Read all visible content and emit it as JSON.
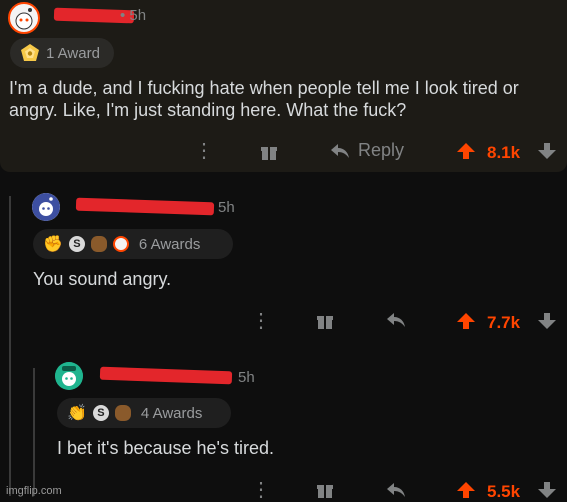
{
  "comments": [
    {
      "time": "• 5h",
      "award_label": "1 Award",
      "body_line1": "I'm a dude, and I fucking hate when people tell me I look tired or",
      "body_line2": "angry. Like, I'm just standing here. What the fuck?",
      "reply_label": "Reply",
      "vote_count": "8.1k"
    },
    {
      "time": "5h",
      "award_label": "6 Awards",
      "body": "You sound angry.",
      "vote_count": "7.7k"
    },
    {
      "time": "5h",
      "award_label": "4 Awards",
      "body": "I bet it's because he's tired.",
      "vote_count": "5.5k"
    }
  ],
  "watermark": "imgflip.com",
  "colors": {
    "upvote": "#ff4500",
    "background": "#0e0e0e",
    "highlight_bg": "#1d1b16",
    "redaction": "#e3262b"
  },
  "icons": [
    "award-icon",
    "gift-icon",
    "reply-arrow-icon",
    "upvote-arrow-icon",
    "downvote-arrow-icon",
    "more-dots-icon"
  ]
}
